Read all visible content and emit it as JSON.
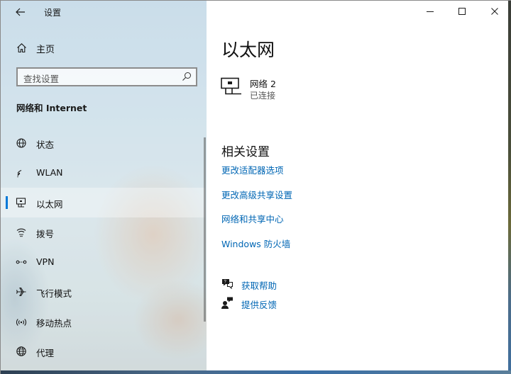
{
  "window": {
    "title": "设置",
    "buttons": {
      "back": "back-arrow-icon",
      "minimize": "minimize-icon",
      "maximize": "maximize-icon",
      "close": "close-icon"
    }
  },
  "sidebar": {
    "home_label": "主页",
    "search": {
      "placeholder": "查找设置"
    },
    "section_title": "网络和 Internet",
    "items": [
      {
        "label": "状态",
        "icon": "globe-status-icon",
        "selected": false
      },
      {
        "label": "WLAN",
        "icon": "wifi-icon",
        "selected": false
      },
      {
        "label": "以太网",
        "icon": "ethernet-icon",
        "selected": true
      },
      {
        "label": "拨号",
        "icon": "dialup-icon",
        "selected": false
      },
      {
        "label": "VPN",
        "icon": "vpn-icon",
        "selected": false
      },
      {
        "label": "飞行模式",
        "icon": "airplane-icon",
        "selected": false
      },
      {
        "label": "移动热点",
        "icon": "hotspot-icon",
        "selected": false
      },
      {
        "label": "代理",
        "icon": "proxy-globe-icon",
        "selected": false
      }
    ]
  },
  "main": {
    "page_title": "以太网",
    "network": {
      "name": "网络 2",
      "status": "已连接"
    },
    "related_title": "相关设置",
    "related_links": [
      "更改适配器选项",
      "更改高级共享设置",
      "网络和共享中心",
      "Windows 防火墙"
    ],
    "help": {
      "get_help": "获取帮助",
      "feedback": "提供反馈"
    }
  },
  "colors": {
    "accent": "#0078d7",
    "link": "#0066b4"
  }
}
